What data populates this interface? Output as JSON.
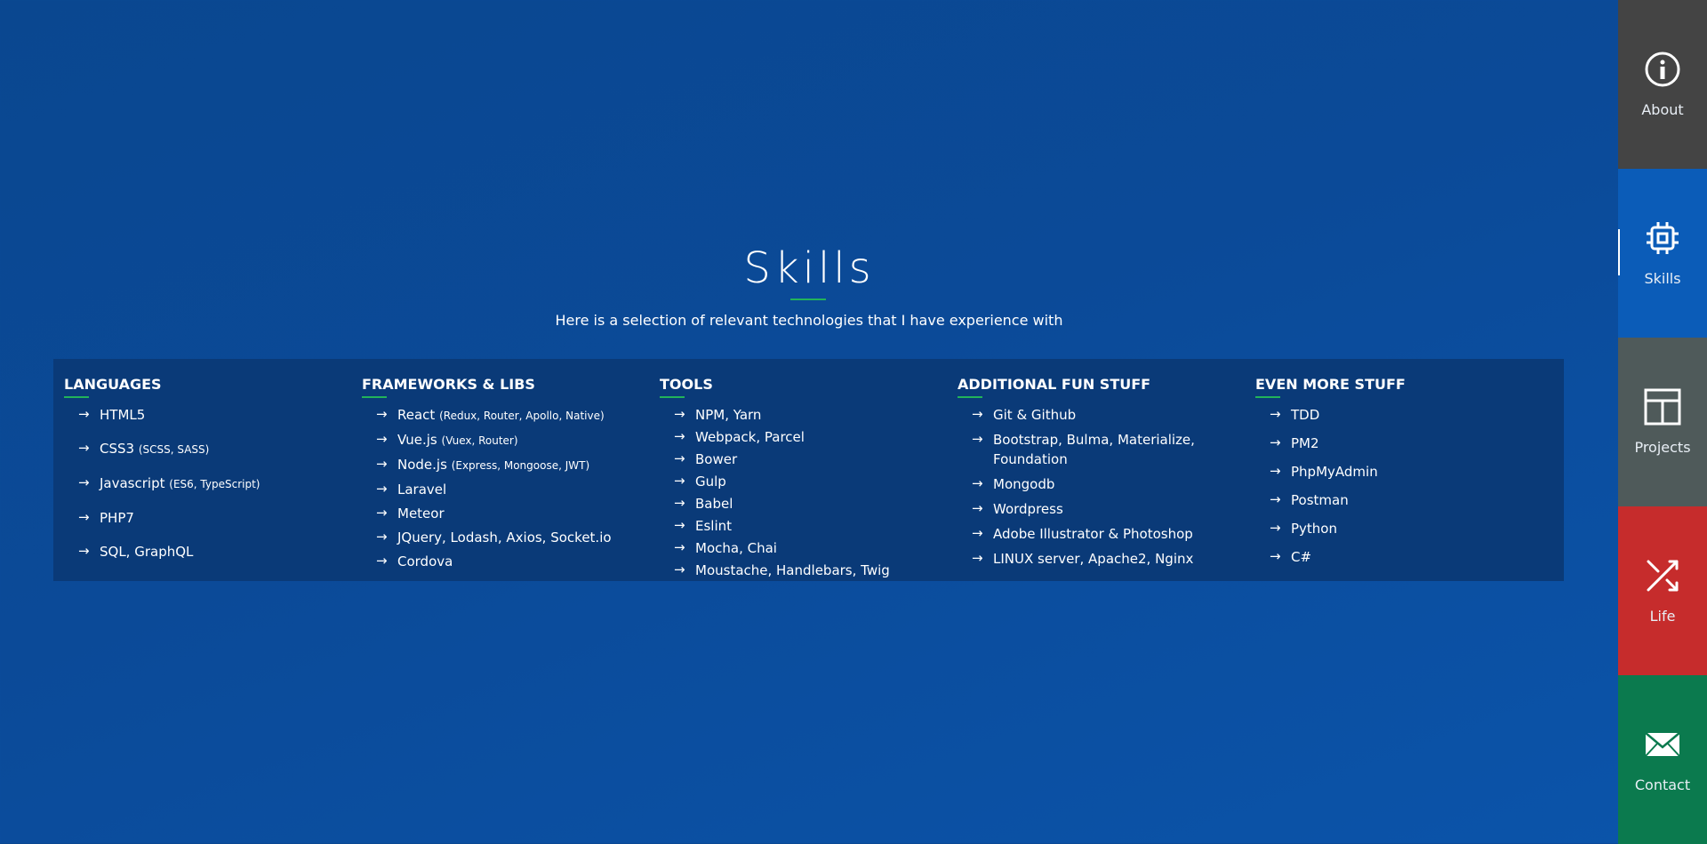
{
  "skills": {
    "title": "Skills",
    "subtitle": "Here is a selection of relevant technologies that I have experience with",
    "columns": [
      {
        "heading": "LANGUAGES",
        "items": [
          {
            "label": "HTML5",
            "detail": ""
          },
          {
            "label": "CSS3",
            "detail": "(SCSS, SASS)"
          },
          {
            "label": "Javascript",
            "detail": "(ES6, TypeScript)"
          },
          {
            "label": "PHP7",
            "detail": ""
          },
          {
            "label": "SQL, GraphQL",
            "detail": ""
          }
        ]
      },
      {
        "heading": "FRAMEWORKS & LIBS",
        "items": [
          {
            "label": "React",
            "detail": "(Redux, Router, Apollo, Native)"
          },
          {
            "label": "Vue.js",
            "detail": "(Vuex, Router)"
          },
          {
            "label": "Node.js",
            "detail": "(Express, Mongoose, JWT)"
          },
          {
            "label": "Laravel",
            "detail": ""
          },
          {
            "label": "Meteor",
            "detail": ""
          },
          {
            "label": "JQuery, Lodash, Axios, Socket.io",
            "detail": ""
          },
          {
            "label": "Cordova",
            "detail": ""
          }
        ]
      },
      {
        "heading": "TOOLS",
        "items": [
          {
            "label": "NPM, Yarn",
            "detail": ""
          },
          {
            "label": "Webpack, Parcel",
            "detail": ""
          },
          {
            "label": "Bower",
            "detail": ""
          },
          {
            "label": "Gulp",
            "detail": ""
          },
          {
            "label": "Babel",
            "detail": ""
          },
          {
            "label": "Eslint",
            "detail": ""
          },
          {
            "label": "Mocha, Chai",
            "detail": ""
          },
          {
            "label": "Moustache, Handlebars, Twig",
            "detail": ""
          }
        ]
      },
      {
        "heading": "ADDITIONAL FUN STUFF",
        "items": [
          {
            "label": "Git & Github",
            "detail": ""
          },
          {
            "label": "Bootstrap, Bulma, Materialize, Foundation",
            "detail": ""
          },
          {
            "label": "Mongodb",
            "detail": ""
          },
          {
            "label": "Wordpress",
            "detail": ""
          },
          {
            "label": "Adobe Illustrator & Photoshop",
            "detail": ""
          },
          {
            "label": "LINUX server, Apache2, Nginx",
            "detail": ""
          }
        ]
      },
      {
        "heading": "EVEN MORE STUFF",
        "items": [
          {
            "label": "TDD",
            "detail": ""
          },
          {
            "label": "PM2",
            "detail": ""
          },
          {
            "label": "PhpMyAdmin",
            "detail": ""
          },
          {
            "label": "Postman",
            "detail": ""
          },
          {
            "label": "Python",
            "detail": ""
          },
          {
            "label": "C#",
            "detail": ""
          }
        ]
      }
    ]
  },
  "nav": {
    "items": [
      {
        "label": "About",
        "icon": "info-icon",
        "color": "#444444"
      },
      {
        "label": "Skills",
        "icon": "chip-icon",
        "color": "#0b5cb8",
        "active": true
      },
      {
        "label": "Projects",
        "icon": "table-icon",
        "color": "#4f5a5a"
      },
      {
        "label": "Life",
        "icon": "shuffle-icon",
        "color": "#c62c2c"
      },
      {
        "label": "Contact",
        "icon": "mail-icon",
        "color": "#0b7a4e"
      }
    ]
  },
  "colors": {
    "accent": "#22b35a",
    "panel": "#0a3a78"
  }
}
